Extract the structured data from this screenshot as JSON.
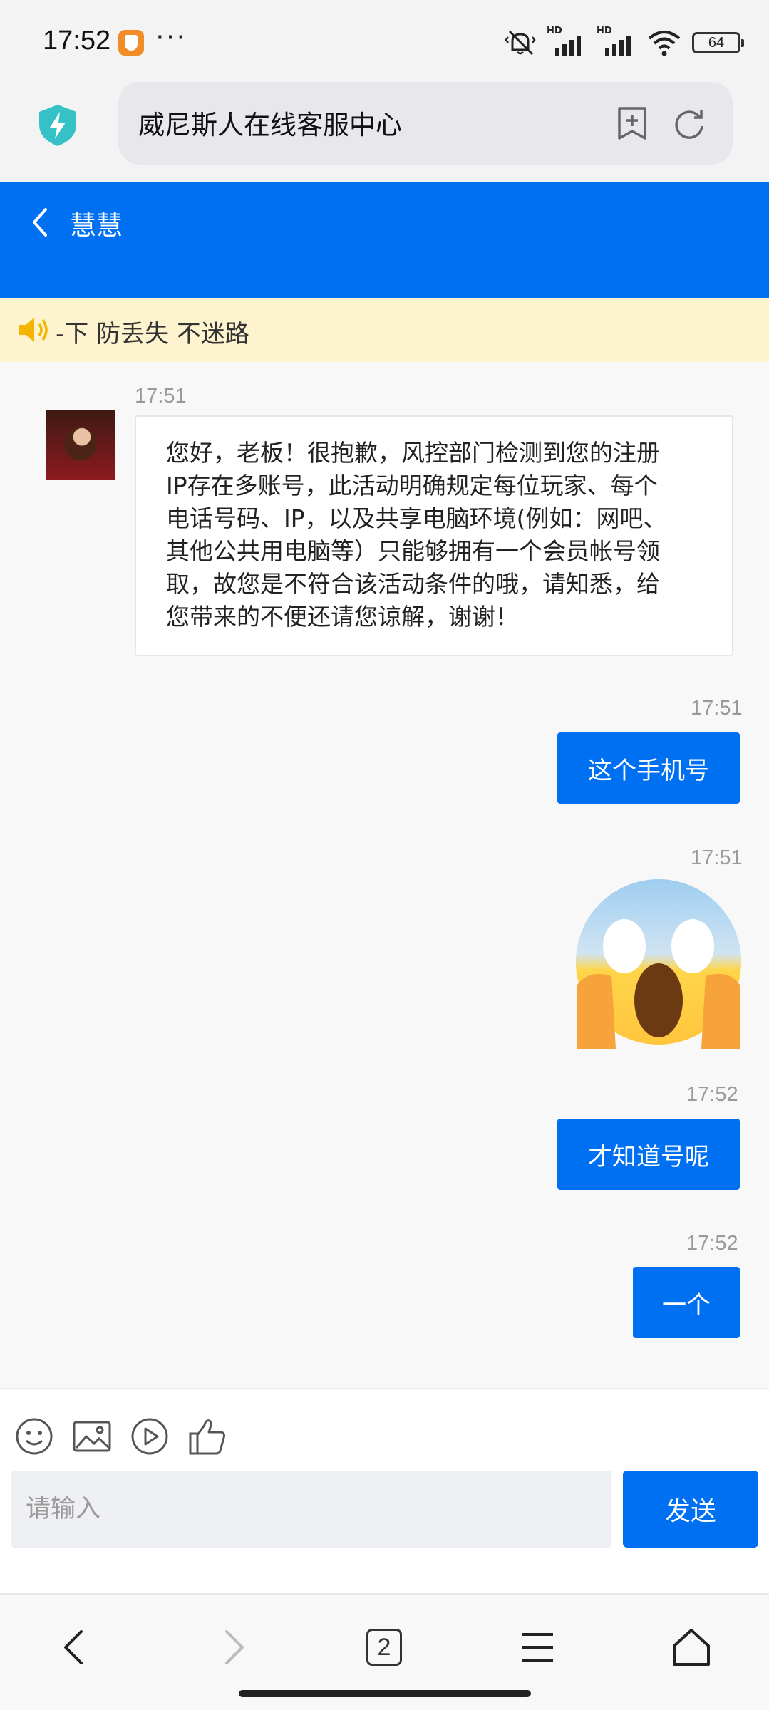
{
  "status_bar": {
    "time": "17:52",
    "more": "···",
    "signal_1_label": "HD",
    "signal_2_label": "HD",
    "battery": "64"
  },
  "browser": {
    "url_title": "威尼斯人在线客服中心"
  },
  "chat_header": {
    "agent_name": "慧慧"
  },
  "notice": {
    "text": "-下 防丢失 不迷路"
  },
  "messages": [
    {
      "direction": "incoming",
      "time": "17:51",
      "text": "您好，老板！很抱歉，风控部门检测到您的注册\nIP存在多账号，此活动明确规定每位玩家、每个\n电话号码、IP，以及共享电脑环境(例如：网吧、\n其他公共用电脑等）只能够拥有一个会员帐号领\n取，故您是不符合该活动条件的哦，请知悉，给\n您带来的不便还请您谅解，谢谢！"
    },
    {
      "direction": "outgoing",
      "time": "17:51",
      "text": "这个手机号"
    },
    {
      "direction": "outgoing",
      "time": "17:51",
      "emoji": "scream-emoji"
    },
    {
      "direction": "outgoing",
      "time": "17:52",
      "text": "才知道号呢"
    },
    {
      "direction": "outgoing",
      "time": "17:52",
      "text": "一个"
    }
  ],
  "composer": {
    "placeholder": "请输入",
    "send_label": "发送",
    "tools": [
      "emoji-icon",
      "image-icon",
      "video-icon",
      "thumbs-up-icon"
    ]
  },
  "nav_bar": {
    "tab_count": "2"
  },
  "colors": {
    "accent": "#0070f3",
    "notice_bg": "#fdf3cf",
    "speaker": "#f5b400"
  }
}
